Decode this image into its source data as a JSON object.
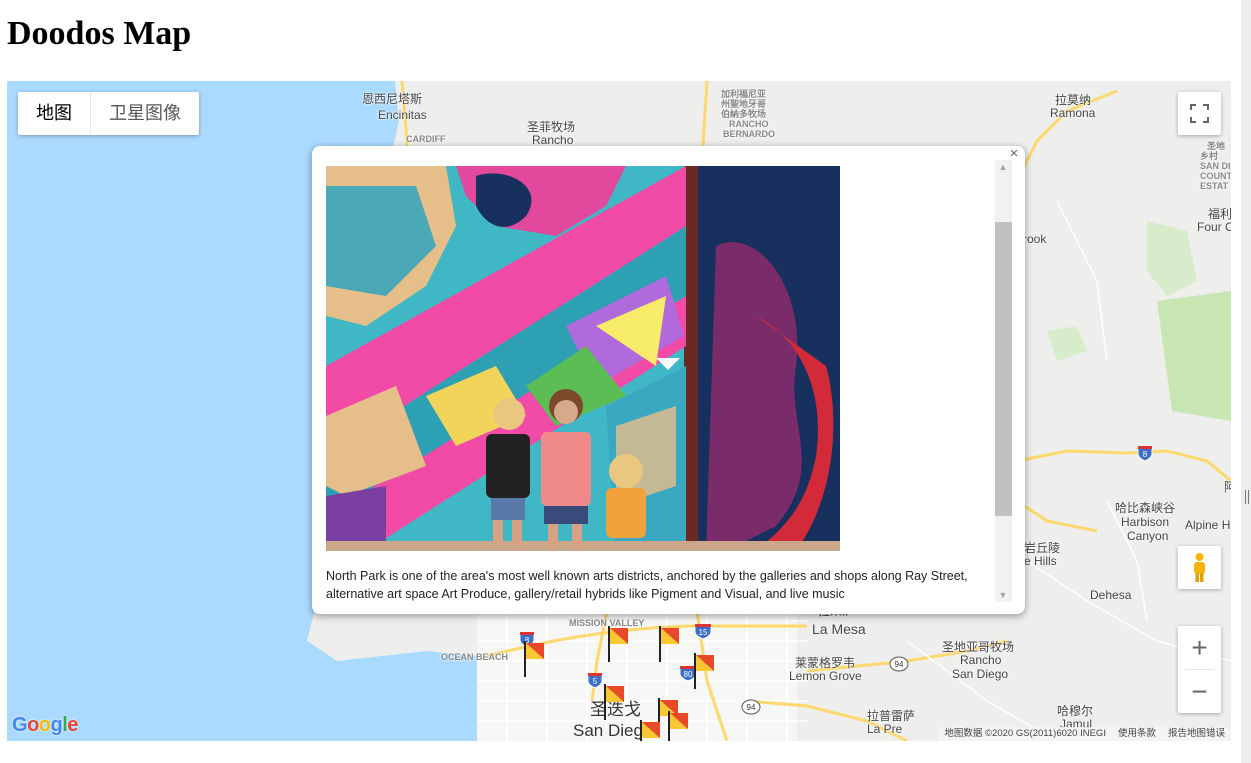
{
  "page": {
    "title": "Doodos Map"
  },
  "map": {
    "type_controls": {
      "map_label": "地图",
      "satellite_label": "卫星图像"
    },
    "labels": {
      "encinitas_cn": "恩西尼塔斯",
      "encinitas": "Encinitas",
      "cardiff": "CARDIFF",
      "santafe_cn": "圣菲牧场",
      "santafe": "Rancho",
      "rb_cn1": "加利福尼亚",
      "rb_cn2": "州聖地牙哥",
      "rb_cn3": "伯納多牧场",
      "rb1": "RANCHO",
      "rb2": "BERNARDO",
      "ramona_cn": "拉莫纳",
      "ramona": "Ramona",
      "estate1": "圣地",
      "estate2": "乡村",
      "estate3": "SAN DI",
      "estate4": "COUNT",
      "estate5": "ESTAT",
      "four_cn": "福利",
      "four": "Four C",
      "rook": "rook",
      "harbison_cn": "哈比森峡谷",
      "harbison1": "Harbison",
      "harbison2": "Canyon",
      "alpine": "Alpine H",
      "cresthills_cn": "岩丘陵",
      "cresthills": "e Hills",
      "dehesa": "Dehesa",
      "lamesa_cn": "拉米萨",
      "lamesa": "La Mesa",
      "lemon_cn": "莱蒙格罗韦",
      "lemon": "Lemon Grove",
      "rsd_cn": "圣地亚哥牧场",
      "rsd1": "Rancho",
      "rsd2": "San Diego",
      "mission": "MISSION VALLEY",
      "ocean": "OCEAN BEACH",
      "sd_cn": "圣迭戈",
      "sd": "San Diego",
      "lapresa_cn": "拉普雷萨",
      "lapresa": "La Pre",
      "jamul_cn": "哈穆尔",
      "jamul": "Jamul",
      "shield_8": "8",
      "shield_8w": "8",
      "shield_15": "15",
      "shield_5": "5",
      "shield_80": "80",
      "shield_94a": "94",
      "shield_94b": "94",
      "mtn": "阿"
    },
    "attribution": {
      "data": "地图数据 ©2020 GS(2011)6020 INEGI",
      "terms": "使用条款",
      "report": "报告地图错误"
    },
    "google_logo": [
      "G",
      "o",
      "o",
      "g",
      "l",
      "e"
    ],
    "icons": {
      "fullscreen": "fullscreen-icon",
      "pegman": "pegman-icon",
      "zoom_in": "+",
      "zoom_out": "−"
    },
    "colors": {
      "water": "#aadaff",
      "land": "#eeeeec",
      "park": "#c8e6b4",
      "highway": "#fdd86c",
      "marker_red": "#e8492b",
      "marker_yellow": "#f9c731"
    }
  },
  "infowindow": {
    "close": "×",
    "image_alt": "children-in-front-of-mural",
    "caption": "North Park is one of the area's most well known arts districts, anchored by the galleries and shops along Ray Street, alternative art space Art Produce, gallery/retail hybrids like Pigment and Visual, and live music",
    "scroll_up": "▲",
    "scroll_down": "▼"
  }
}
